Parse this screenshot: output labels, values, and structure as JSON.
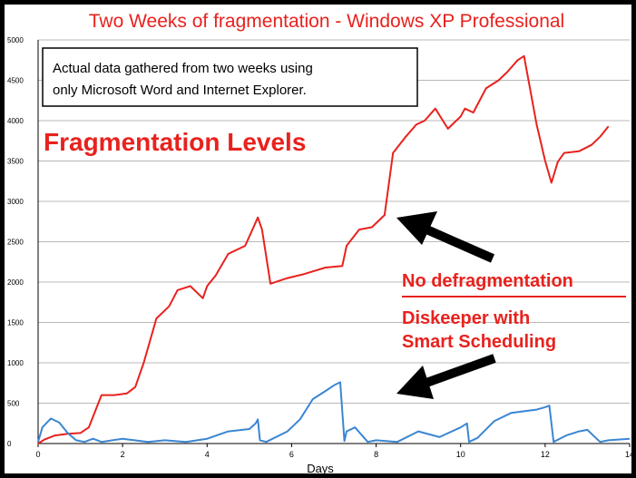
{
  "chart_data": {
    "type": "line",
    "title": "Two Weeks of fragmentation - Windows XP Professional",
    "xlabel": "Days",
    "ylabel": "",
    "xlim": [
      0,
      14
    ],
    "ylim": [
      0,
      5000
    ],
    "x_ticks": [
      "0",
      "2",
      "4",
      "6",
      "8",
      "10",
      "12",
      "14"
    ],
    "y_ticks": [
      "0",
      "500",
      "1000",
      "1500",
      "2000",
      "2500",
      "3000",
      "3500",
      "4000",
      "4500",
      "5000"
    ],
    "grid": true,
    "colors": {
      "title": "#e8221e",
      "no_defrag": "#e8221e",
      "diskeeper": "#3b86d2",
      "grid": "#b8b8b8",
      "arrow": "#000000"
    },
    "annotations": {
      "note_line1": "Actual data gathered from two weeks using",
      "note_line2": "only Microsoft Word and Internet Explorer.",
      "big_label": "Fragmentation Levels",
      "legend_red": "No defragmentation",
      "legend_blue_line1": "Diskeeper with",
      "legend_blue_line2": "Smart Scheduling"
    },
    "series": [
      {
        "name": "No defragmentation",
        "color": "#e8221e",
        "x": [
          0,
          0.15,
          0.4,
          0.7,
          1.0,
          1.2,
          1.35,
          1.5,
          1.8,
          2.1,
          2.3,
          2.5,
          2.8,
          3.1,
          3.3,
          3.6,
          3.9,
          4.0,
          4.2,
          4.5,
          4.9,
          5.2,
          5.3,
          5.5,
          5.9,
          6.3,
          6.8,
          7.2,
          7.3,
          7.6,
          7.9,
          8.0,
          8.2,
          8.4,
          8.7,
          8.95,
          9.15,
          9.4,
          9.7,
          10.0,
          10.1,
          10.3,
          10.6,
          10.9,
          11.1,
          11.35,
          11.5,
          11.8,
          12.0,
          12.15,
          12.3,
          12.45,
          12.8,
          13.1,
          13.3,
          13.5
        ],
        "y": [
          0,
          50,
          100,
          120,
          130,
          200,
          400,
          600,
          600,
          620,
          700,
          1000,
          1550,
          1700,
          1900,
          1950,
          1800,
          1950,
          2080,
          2350,
          2450,
          2800,
          2650,
          1980,
          2050,
          2100,
          2180,
          2200,
          2450,
          2650,
          2680,
          2730,
          2830,
          3600,
          3800,
          3950,
          4000,
          4150,
          3900,
          4050,
          4150,
          4100,
          4400,
          4500,
          4600,
          4750,
          4800,
          3950,
          3500,
          3230,
          3490,
          3600,
          3620,
          3700,
          3800,
          3930
        ]
      },
      {
        "name": "Diskeeper with Smart Scheduling",
        "color": "#3b86d2",
        "x": [
          0,
          0.1,
          0.3,
          0.5,
          0.7,
          0.9,
          1.1,
          1.3,
          1.5,
          2.0,
          2.6,
          3.0,
          3.5,
          4.0,
          4.5,
          5.0,
          5.15,
          5.2,
          5.25,
          5.4,
          5.9,
          6.0,
          6.2,
          6.5,
          6.8,
          7.0,
          7.15,
          7.25,
          7.3,
          7.5,
          7.8,
          8.0,
          8.5,
          9.0,
          9.5,
          10.0,
          10.15,
          10.2,
          10.4,
          10.8,
          11.2,
          11.5,
          11.8,
          12.0,
          12.1,
          12.2,
          12.5,
          12.8,
          13.0,
          13.2,
          13.3,
          13.5,
          14.0
        ],
        "y": [
          20,
          200,
          310,
          260,
          130,
          40,
          20,
          60,
          20,
          60,
          20,
          40,
          20,
          60,
          150,
          180,
          250,
          300,
          40,
          20,
          150,
          200,
          300,
          550,
          650,
          720,
          760,
          30,
          150,
          200,
          20,
          40,
          20,
          150,
          80,
          200,
          250,
          20,
          70,
          280,
          380,
          400,
          420,
          450,
          470,
          20,
          100,
          150,
          170,
          70,
          20,
          40,
          60
        ]
      }
    ]
  }
}
